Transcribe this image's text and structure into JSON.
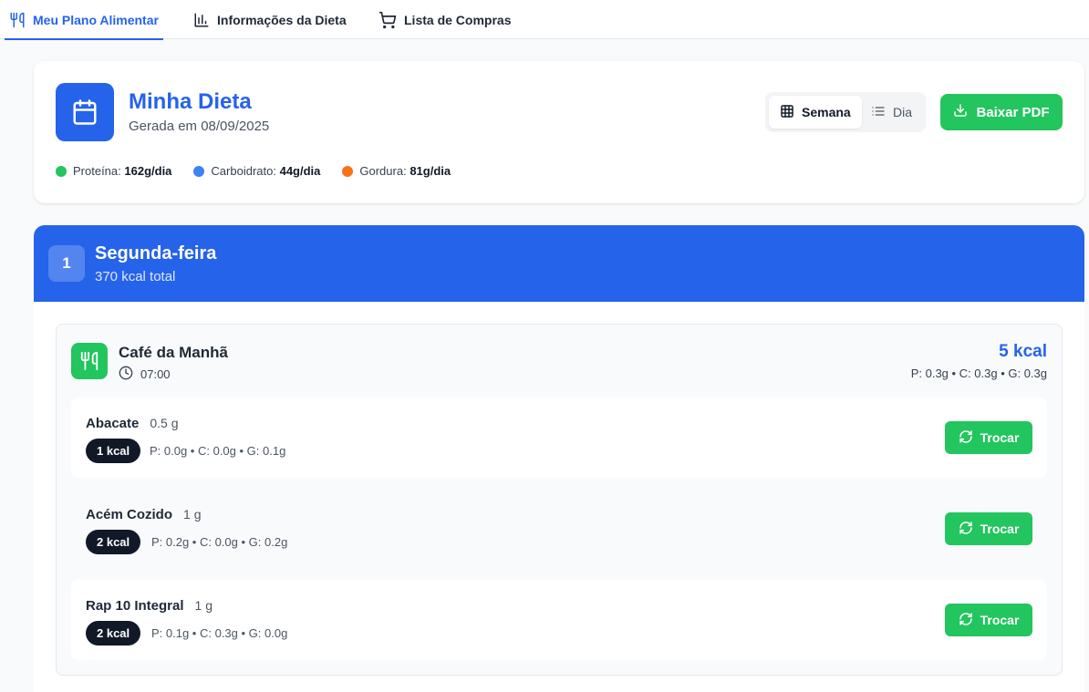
{
  "tabs": [
    {
      "label": "Meu Plano Alimentar",
      "active": true,
      "icon": "utensils-icon"
    },
    {
      "label": "Informações da Dieta",
      "active": false,
      "icon": "bar-chart-icon"
    },
    {
      "label": "Lista de Compras",
      "active": false,
      "icon": "shopping-cart-icon"
    }
  ],
  "header": {
    "title": "Minha Dieta",
    "subtitle": "Gerada em 08/09/2025",
    "macros": [
      {
        "label": "Proteína:",
        "value": "162g/dia",
        "color": "#22c55e"
      },
      {
        "label": "Carboidrato:",
        "value": "44g/dia",
        "color": "#3b82f6"
      },
      {
        "label": "Gordura:",
        "value": "81g/dia",
        "color": "#f97316"
      }
    ],
    "view_toggle": {
      "week_label": "Semana",
      "day_label": "Dia",
      "selected": "Semana"
    },
    "download_label": "Baixar PDF"
  },
  "day": {
    "number": "1",
    "name": "Segunda-feira",
    "total_kcal": "370 kcal total"
  },
  "meal": {
    "name": "Café da Manhã",
    "time": "07:00",
    "kcal": "5 kcal",
    "macros": "P: 0.3g • C: 0.3g • G: 0.3g",
    "foods": [
      {
        "name": "Abacate",
        "qty": "0.5 g",
        "kcal": "1 kcal",
        "macros": "P: 0.0g • C: 0.0g • G: 0.1g",
        "swap_label": "Trocar"
      },
      {
        "name": "Acém Cozido",
        "qty": "1 g",
        "kcal": "2 kcal",
        "macros": "P: 0.2g • C: 0.0g • G: 0.2g",
        "swap_label": "Trocar"
      },
      {
        "name": "Rap 10 Integral",
        "qty": "1 g",
        "kcal": "2 kcal",
        "macros": "P: 0.1g • C: 0.3g • G: 0.0g",
        "swap_label": "Trocar"
      }
    ]
  },
  "colors": {
    "primary": "#2563eb",
    "success": "#22c55e",
    "dark": "#111827"
  }
}
